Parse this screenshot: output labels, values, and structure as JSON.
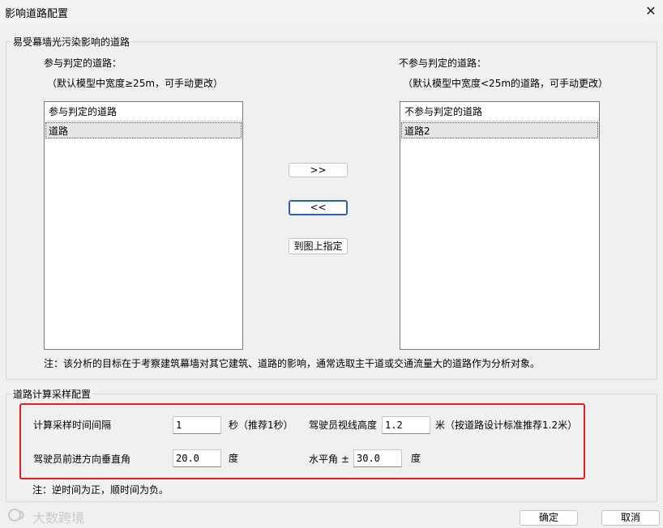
{
  "window": {
    "title": "影响道路配置",
    "close_glyph": "✕"
  },
  "group_roads": {
    "label": "易受幕墙光污染影响的道路",
    "left_caption": "参与判定的道路：",
    "left_hint": "（默认模型中宽度≥25m，可手动更改）",
    "right_caption": "不参与判定的道路：",
    "right_hint": "（默认模型中宽度<25m的道路，可手动更改）",
    "left_list": {
      "header": "参与判定的道路",
      "items": [
        "道路"
      ]
    },
    "right_list": {
      "header": "不参与判定的道路",
      "items": [
        "道路2"
      ]
    },
    "btn_move_right": ">>",
    "btn_move_left": "<<",
    "btn_pick": "到图上指定",
    "note": "注：该分析的目标在于考察建筑幕墙对其它建筑、道路的影响，通常选取主干道或交通流量大的道路作为分析对象。"
  },
  "group_sampling": {
    "label": "道路计算采样配置",
    "interval_label": "计算采样时间间隔",
    "interval_value": "1",
    "interval_unit": "秒（推荐1秒）",
    "eye_height_label": "驾驶员视线高度",
    "eye_height_value": "1.2",
    "eye_height_unit": "米（按道路设计标准推荐1.2米）",
    "vertical_angle_label": "驾驶员前进方向垂直角",
    "vertical_angle_value": "20.0",
    "vertical_angle_unit": "度",
    "horizontal_angle_label": "水平角 ±",
    "horizontal_angle_value": "30.0",
    "horizontal_angle_unit": "度",
    "note": "注：逆时间为正，顺时间为负。"
  },
  "footer": {
    "ok": "确定",
    "cancel": "取消",
    "watermark": "大数跨境"
  },
  "colors": {
    "highlight_border": "#e02020",
    "focus_border": "#2b5fb3"
  }
}
